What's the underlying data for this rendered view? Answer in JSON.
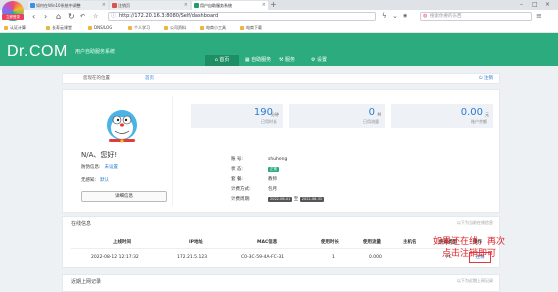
{
  "browser": {
    "logo_label": "立即登录",
    "tabs": [
      {
        "title": "如何在Win10系统中调整"
      },
      {
        "title": "注销页"
      },
      {
        "title": "用户自助服务系统"
      }
    ],
    "url": "http://172.20.16.3:8080/Self/dashboard",
    "search_placeholder": "搜索你要的东西",
    "bookmarks": [
      "认证计算",
      "长寿云课堂",
      "DNS/LOG",
      "个人学习",
      "公司资料",
      "电商小工具",
      "电商下载"
    ]
  },
  "app": {
    "brand": "Dr.COM",
    "subtitle": "用户自助服务系统",
    "nav": [
      "首页",
      "自助服务",
      "服务",
      "设置"
    ],
    "breadcrumb_label": "您现在的位置",
    "breadcrumb_link": "首页",
    "logout_link": "注销"
  },
  "profile": {
    "greeting": "N/A、您好!",
    "anti_proxy_label": "防伪信息:",
    "anti_proxy_value": "未设置",
    "sense_label": "无感知:",
    "sense_value": "默认",
    "detail_button": "详细信息"
  },
  "stats": [
    {
      "value": "190",
      "unit": "分钟",
      "label": "已用时长"
    },
    {
      "value": "0",
      "unit": "M",
      "label": "已用流量"
    },
    {
      "value": "0.00",
      "unit": "元",
      "label": "账户余额"
    }
  ],
  "account": {
    "rows": [
      {
        "key": "账  号:",
        "value": "shuheng"
      },
      {
        "key": "状  态:",
        "value": "正常",
        "badge": true
      },
      {
        "key": "套  餐:",
        "value": "教师"
      },
      {
        "key": "计费方式:",
        "value": "包月"
      },
      {
        "key": "计费周期:",
        "value": "2022-08-01 至 2022-08-31",
        "dates": [
          "2022-08-01",
          "2022-08-31"
        ],
        "sep": "至"
      }
    ]
  },
  "online": {
    "title": "在线信息",
    "right_text": "以下为当前在线信息",
    "headers": [
      "上线时间",
      "IP地址",
      "MAC信息",
      "使用时长",
      "使用流量",
      "主机名",
      "终端类型",
      "操作"
    ],
    "rows": [
      [
        "2022-08-12 12:17:32",
        "172.21.5.123",
        "C0-3C-59-4A-FC-31",
        "1",
        "0.000",
        "",
        "PC",
        "注销"
      ]
    ]
  },
  "annotation": {
    "line1": "如果还在线，再次",
    "line2": "点击注销即可"
  },
  "recent": {
    "title": "近期上网记录",
    "right_text": "以下为近期上网记录"
  },
  "colors": {
    "brand_green": "#2cac7e",
    "link_blue": "#2b7bd1",
    "annotation_red": "#e0262b"
  }
}
